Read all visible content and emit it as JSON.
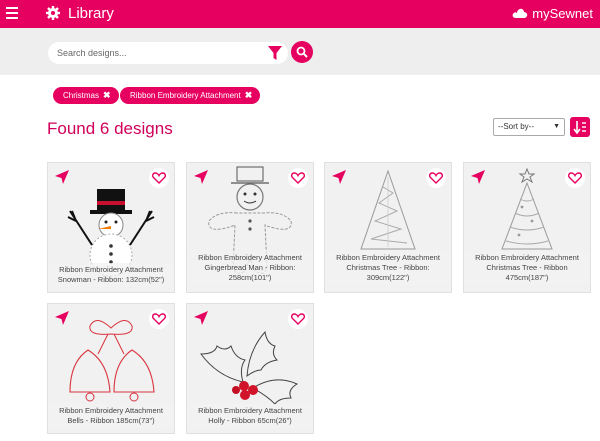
{
  "header": {
    "title": "Library",
    "brand": "mySewnet",
    "accent": "#e6005f"
  },
  "search": {
    "placeholder": "Search designs..."
  },
  "filters": {
    "chips": [
      {
        "label": "Christmas"
      },
      {
        "label": "Ribbon Embroidery Attachment"
      }
    ]
  },
  "results": {
    "title": "Found 6 designs",
    "sort_selected": "--Sort by--"
  },
  "designs": [
    {
      "line1": "Ribbon Embroidery Attachment",
      "line2": "Snowman - Ribbon: 132cm(52\")",
      "thumb": "snowman"
    },
    {
      "line1": "Ribbon Embroidery Attachment",
      "line2": "Gingerbread Man - Ribbon: 258cm(101\")",
      "thumb": "gingerbread-man"
    },
    {
      "line1": "Ribbon Embroidery Attachment",
      "line2": "Christmas Tree - Ribbon: 309cm(122\")",
      "thumb": "christmas-tree"
    },
    {
      "line1": "Ribbon Embroidery Attachment",
      "line2": "Christmas Tree - Ribbon 475cm(187\")",
      "thumb": "christmas-tree-star"
    },
    {
      "line1": "Ribbon Embroidery Attachment",
      "line2": "Bells - Ribbon 185cm(73\")",
      "thumb": "bells"
    },
    {
      "line1": "Ribbon Embroidery Attachment",
      "line2": "Holly - Ribbon 65cm(26\")",
      "thumb": "holly"
    }
  ],
  "icons": {
    "menu": "hamburger-icon",
    "settings": "gear-icon",
    "brand": "cloud-icon",
    "filter": "filter-icon",
    "search": "search-icon",
    "sort_direction": "sort-icon",
    "send": "send-icon",
    "favorite": "heart-icon",
    "remove_chip": "close-icon"
  }
}
